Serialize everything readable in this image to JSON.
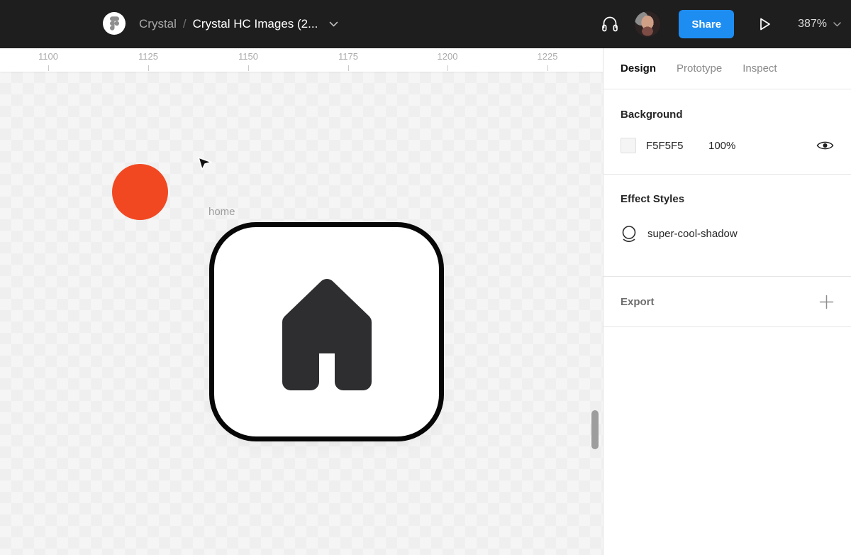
{
  "colors": {
    "topbar-bg": "#1E1E1E",
    "accent-blue": "#1E8DF2",
    "canvas-bg": "#F5F5F5",
    "canvas-check": "#EFEFEF",
    "circle-red": "#F24822",
    "icon-dark": "#2E2E30",
    "panel-divider": "#E6E6E6",
    "text-dark": "#262626",
    "text-gray": "#8A8A8A"
  },
  "topbar": {
    "breadcrumb": {
      "team": "Crystal",
      "separator": "/",
      "file": "Crystal HC Images (2..."
    },
    "share_label": "Share",
    "zoom_level": "387%"
  },
  "canvas": {
    "ruler": {
      "ticks": [
        {
          "label": "1100"
        },
        {
          "label": "1125"
        },
        {
          "label": "1150"
        },
        {
          "label": "1175"
        },
        {
          "label": "1200"
        },
        {
          "label": "1225"
        }
      ]
    },
    "frame_label": "home",
    "objects": {
      "circle_color": "#F24822",
      "frame_fill": "#FFFFFF",
      "frame_border": "#070707",
      "home_icon_color": "#2E2E30"
    }
  },
  "panel": {
    "tabs": [
      {
        "label": "Design",
        "active": true
      },
      {
        "label": "Prototype",
        "active": false
      },
      {
        "label": "Inspect",
        "active": false
      }
    ],
    "background": {
      "title": "Background",
      "hex": "F5F5F5",
      "opacity": "100%"
    },
    "effect_styles": {
      "title": "Effect Styles",
      "items": [
        {
          "name": "super-cool-shadow"
        }
      ]
    },
    "export": {
      "title": "Export"
    }
  }
}
